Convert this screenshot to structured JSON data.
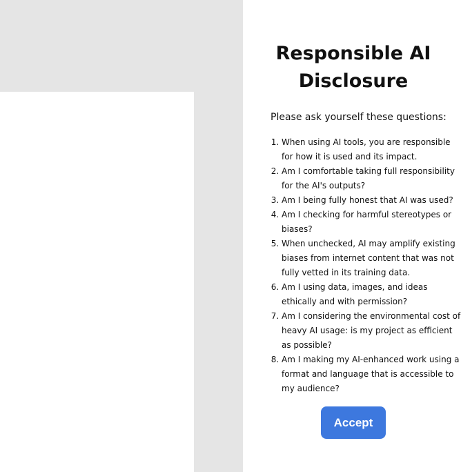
{
  "dialog": {
    "title": "Responsible AI Disclosure",
    "intro": "Please ask yourself these questions:",
    "questions": [
      "When using AI tools, you are responsible for how it is used and its impact.",
      "Am I comfortable taking full responsibility for the AI's outputs?",
      "Am I being fully honest that AI was used?",
      "Am I checking for harmful stereotypes or biases?",
      "When unchecked, AI may amplify existing biases from internet content that was not fully vetted in its training data.",
      "Am I using data, images, and ideas ethically and with permission?",
      "Am I considering the environmental cost of heavy AI usage: is my project as efficient as possible?",
      "Am I making my AI-enhanced work using a format and language that is accessible to my audience?"
    ],
    "accept_label": "Accept",
    "accent_color": "#3d78de"
  }
}
